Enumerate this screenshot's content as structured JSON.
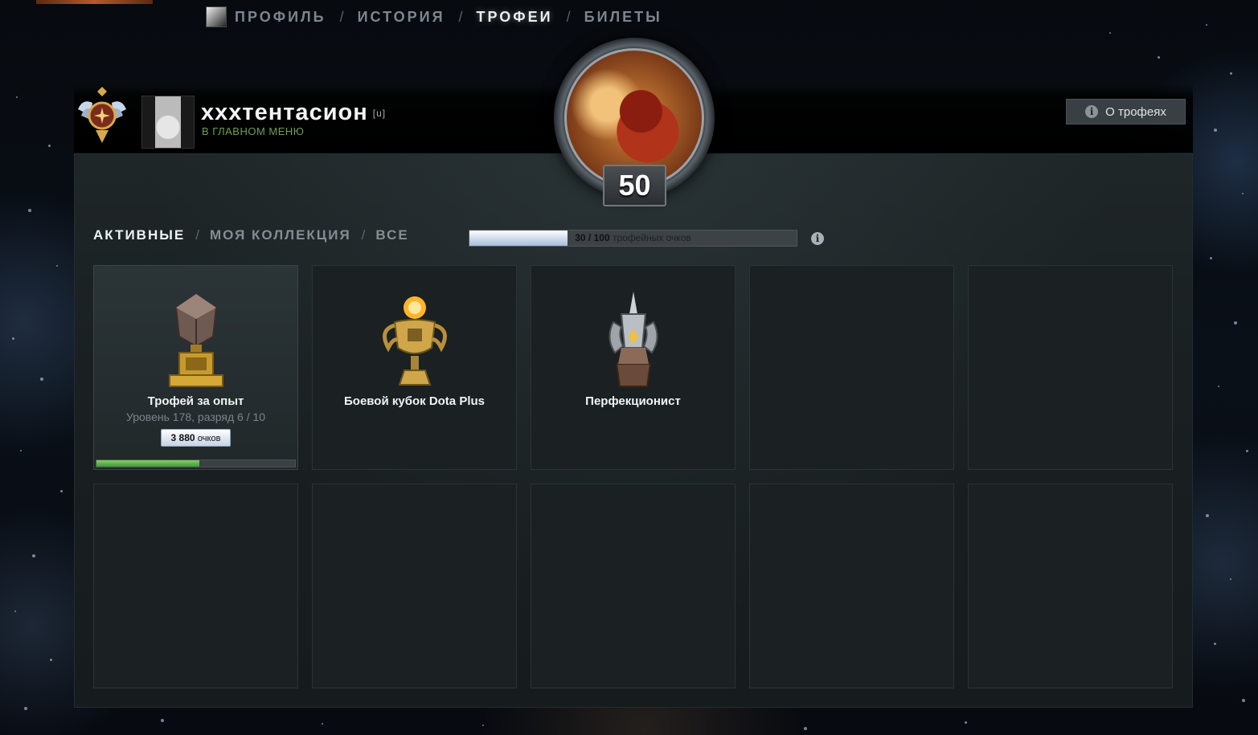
{
  "nav": {
    "items": [
      {
        "label": "ПРОФИЛЬ"
      },
      {
        "label": "ИСТОРИЯ"
      },
      {
        "label": "ТРОФЕИ"
      },
      {
        "label": "БИЛЕТЫ"
      }
    ],
    "separator": "/",
    "active_index": 2
  },
  "user": {
    "name": "xxxтентасион",
    "clan_tag": "[u]",
    "status": "В ГЛАВНОМ МЕНЮ"
  },
  "about_button": {
    "icon": "info-icon",
    "label": "О трофеях"
  },
  "hero": {
    "level": "50"
  },
  "filters": {
    "tabs": [
      {
        "label": "АКТИВНЫЕ"
      },
      {
        "label": "МОЯ КОЛЛЕКЦИЯ"
      },
      {
        "label": "ВСЕ"
      }
    ],
    "separator": "/",
    "active_index": 0
  },
  "trophy_points": {
    "value": "30 / 100",
    "label": "трофейных очков",
    "fraction": 0.3
  },
  "trophies": [
    {
      "name": "Трофей за опыт",
      "subtitle": "Уровень 178, разряд 6 / 10",
      "points_value": "3 880",
      "points_unit": "очков",
      "progress": 0.52
    },
    {
      "name": "Боевой кубок Dota Plus"
    },
    {
      "name": "Перфекционист"
    }
  ],
  "colors": {
    "status_green": "#6f9e55",
    "progress_green": "#3f9a34",
    "panel_bg": "#1b2022"
  }
}
